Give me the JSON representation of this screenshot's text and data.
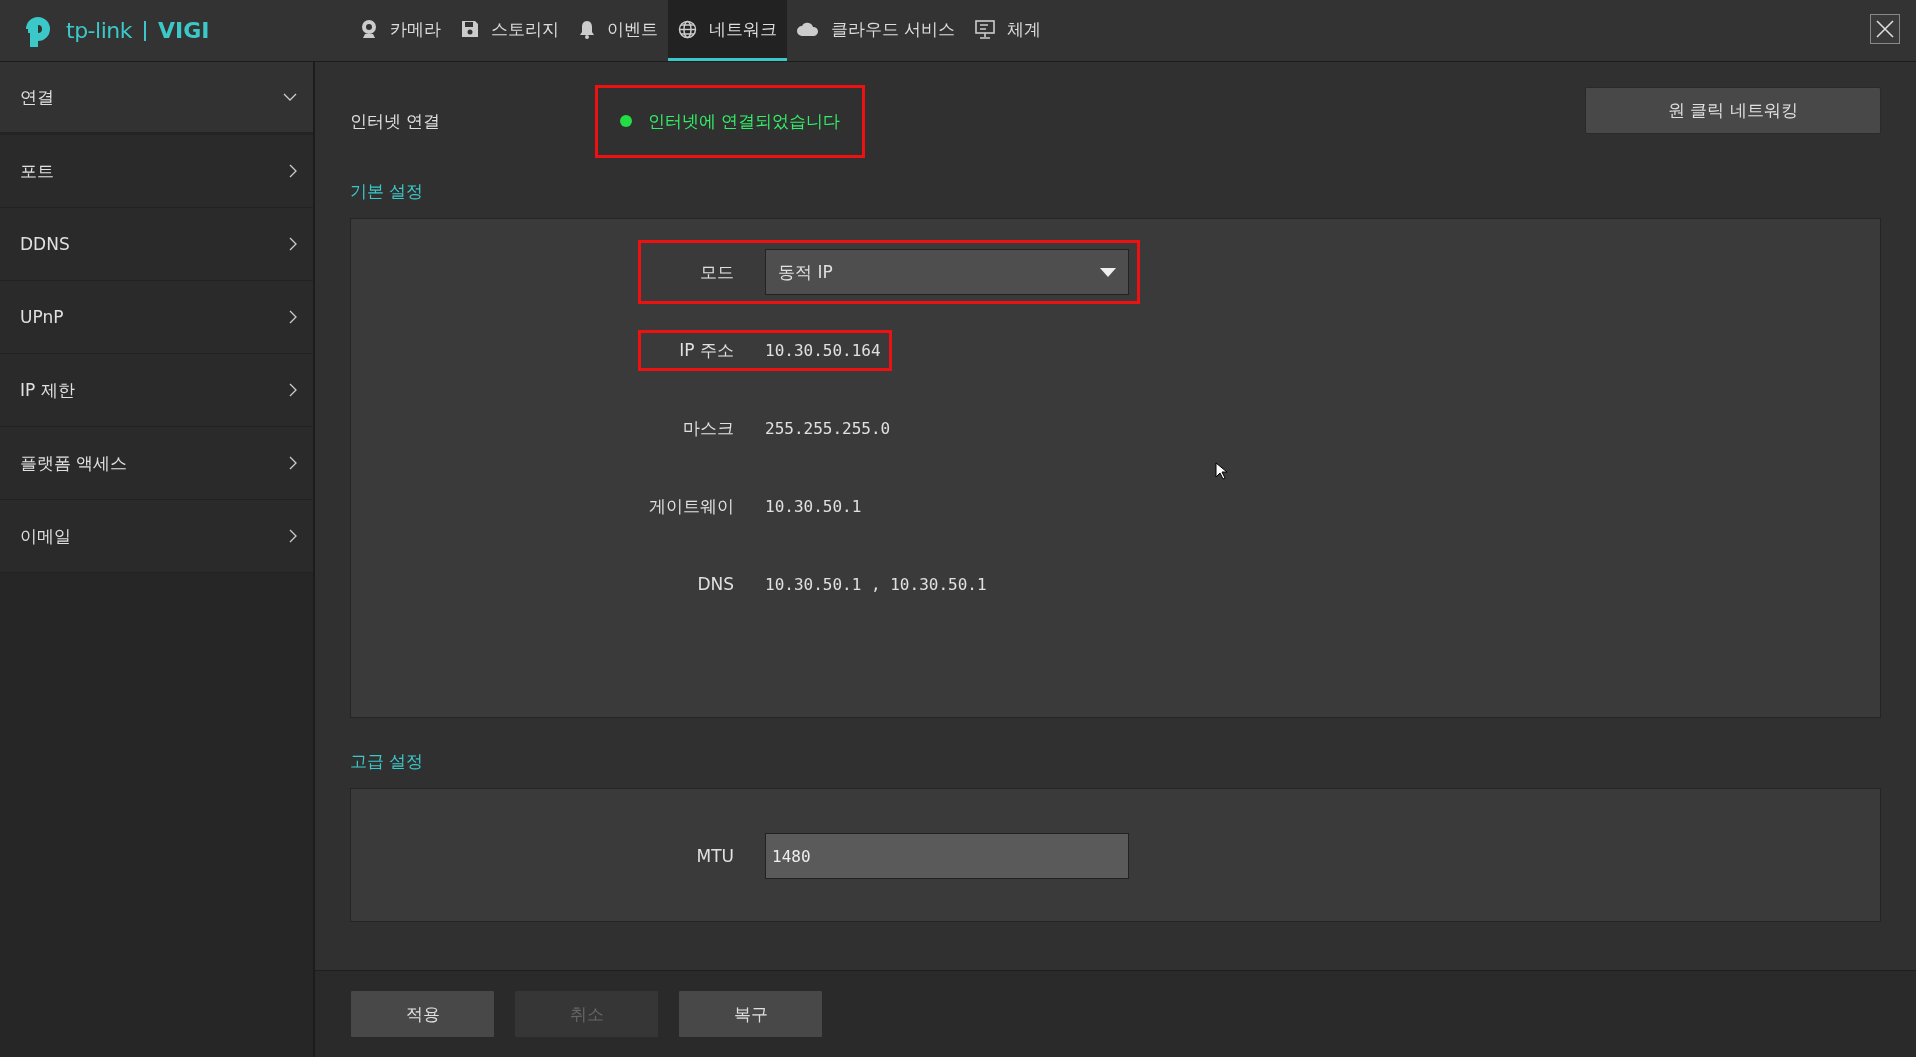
{
  "logo": {
    "brand": "tp-link",
    "product": "VIGI"
  },
  "nav": [
    {
      "label": "카메라",
      "kind": "camera",
      "selected": false
    },
    {
      "label": "스토리지",
      "kind": "storage",
      "selected": false
    },
    {
      "label": "이벤트",
      "kind": "event",
      "selected": false
    },
    {
      "label": "네트워크",
      "kind": "network",
      "selected": true
    },
    {
      "label": "클라우드 서비스",
      "kind": "cloud",
      "selected": false
    },
    {
      "label": "체계",
      "kind": "system",
      "selected": false
    }
  ],
  "sidebar": [
    {
      "label": "연결",
      "expanded": true
    },
    {
      "label": "포트",
      "expanded": false
    },
    {
      "label": "DDNS",
      "expanded": false
    },
    {
      "label": "UPnP",
      "expanded": false
    },
    {
      "label": "IP 제한",
      "expanded": false
    },
    {
      "label": "플랫폼 액세스",
      "expanded": false
    },
    {
      "label": "이메일",
      "expanded": false
    }
  ],
  "internet": {
    "label": "인터넷 연결",
    "status": "인터넷에 연결되었습니다",
    "connected": true,
    "highlighted": true
  },
  "one_click_button": "원 클릭 네트워킹",
  "basic": {
    "title": "기본 설정",
    "fields": [
      {
        "kind": "select",
        "label": "모드",
        "value": "동적 IP",
        "highlighted": true
      },
      {
        "kind": "text",
        "label": "IP 주소",
        "value": "10.30.50.164",
        "highlighted": true
      },
      {
        "kind": "text",
        "label": "마스크",
        "value": "255.255.255.0",
        "highlighted": false
      },
      {
        "kind": "text",
        "label": "게이트웨이",
        "value": "10.30.50.1",
        "highlighted": false
      },
      {
        "kind": "text",
        "label": "DNS",
        "value": "10.30.50.1 , 10.30.50.1",
        "highlighted": false
      }
    ]
  },
  "advanced": {
    "title": "고급 설정",
    "fields": [
      {
        "kind": "input",
        "label": "MTU",
        "value": "1480",
        "highlighted": false
      }
    ]
  },
  "buttons": [
    {
      "label": "적용",
      "disabled": false
    },
    {
      "label": "취소",
      "disabled": true
    },
    {
      "label": "복구",
      "disabled": false
    }
  ]
}
